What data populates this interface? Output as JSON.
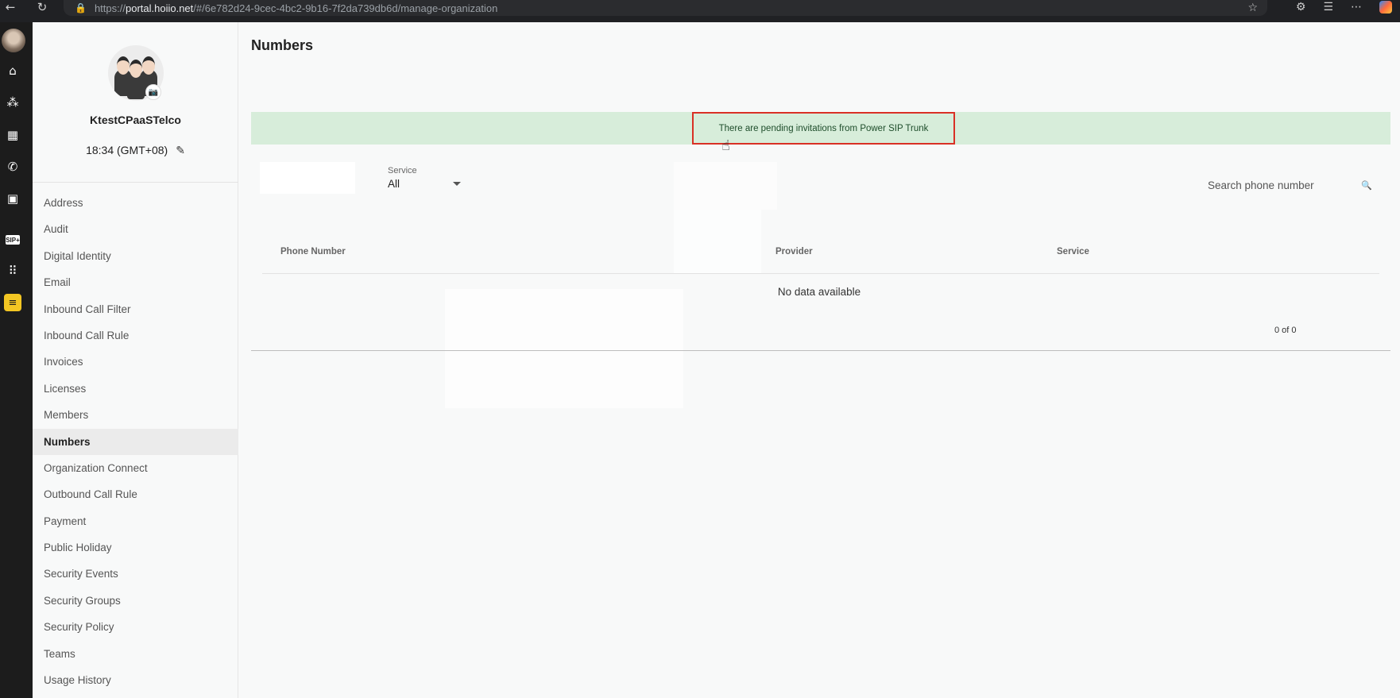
{
  "browser": {
    "url_prefix": "https://",
    "url_host": "portal.hoiio.net",
    "url_path": "/#/6e782d24-9cec-4bc2-9b16-7f2da739db6d/manage-organization",
    "back_icon": "back-arrow-icon",
    "refresh_icon": "refresh-icon",
    "lock_icon": "lock-icon",
    "star_icon": "star-icon"
  },
  "rail": {
    "items": [
      "user-avatar",
      "home-icon",
      "org-icon",
      "dashboard-icon",
      "phone-icon",
      "contacts-icon",
      "sip-icon",
      "apps-grid-icon",
      "yellow-app-icon"
    ],
    "sip_label": "SIP+"
  },
  "org": {
    "name": "KtestCPaaSTelco",
    "time": "18:34 (GMT+08)"
  },
  "menu": {
    "items": [
      {
        "label": "Address"
      },
      {
        "label": "Audit"
      },
      {
        "label": "Digital Identity"
      },
      {
        "label": "Email"
      },
      {
        "label": "Inbound Call Filter"
      },
      {
        "label": "Inbound Call Rule"
      },
      {
        "label": "Invoices"
      },
      {
        "label": "Licenses"
      },
      {
        "label": "Members"
      },
      {
        "label": "Numbers",
        "active": true
      },
      {
        "label": "Organization Connect"
      },
      {
        "label": "Outbound Call Rule"
      },
      {
        "label": "Payment"
      },
      {
        "label": "Public Holiday"
      },
      {
        "label": "Security Events"
      },
      {
        "label": "Security Groups"
      },
      {
        "label": "Security Policy"
      },
      {
        "label": "Teams"
      },
      {
        "label": "Usage History"
      }
    ]
  },
  "main": {
    "title": "Numbers",
    "notice": "There are pending invitations from Power SIP Trunk",
    "service_filter": {
      "label": "Service",
      "value": "All"
    },
    "search": {
      "placeholder": "Search phone number"
    },
    "table": {
      "columns": [
        "Phone Number",
        "Provider",
        "Service"
      ],
      "empty_text": "No data available",
      "pagination": "0 of 0"
    }
  }
}
